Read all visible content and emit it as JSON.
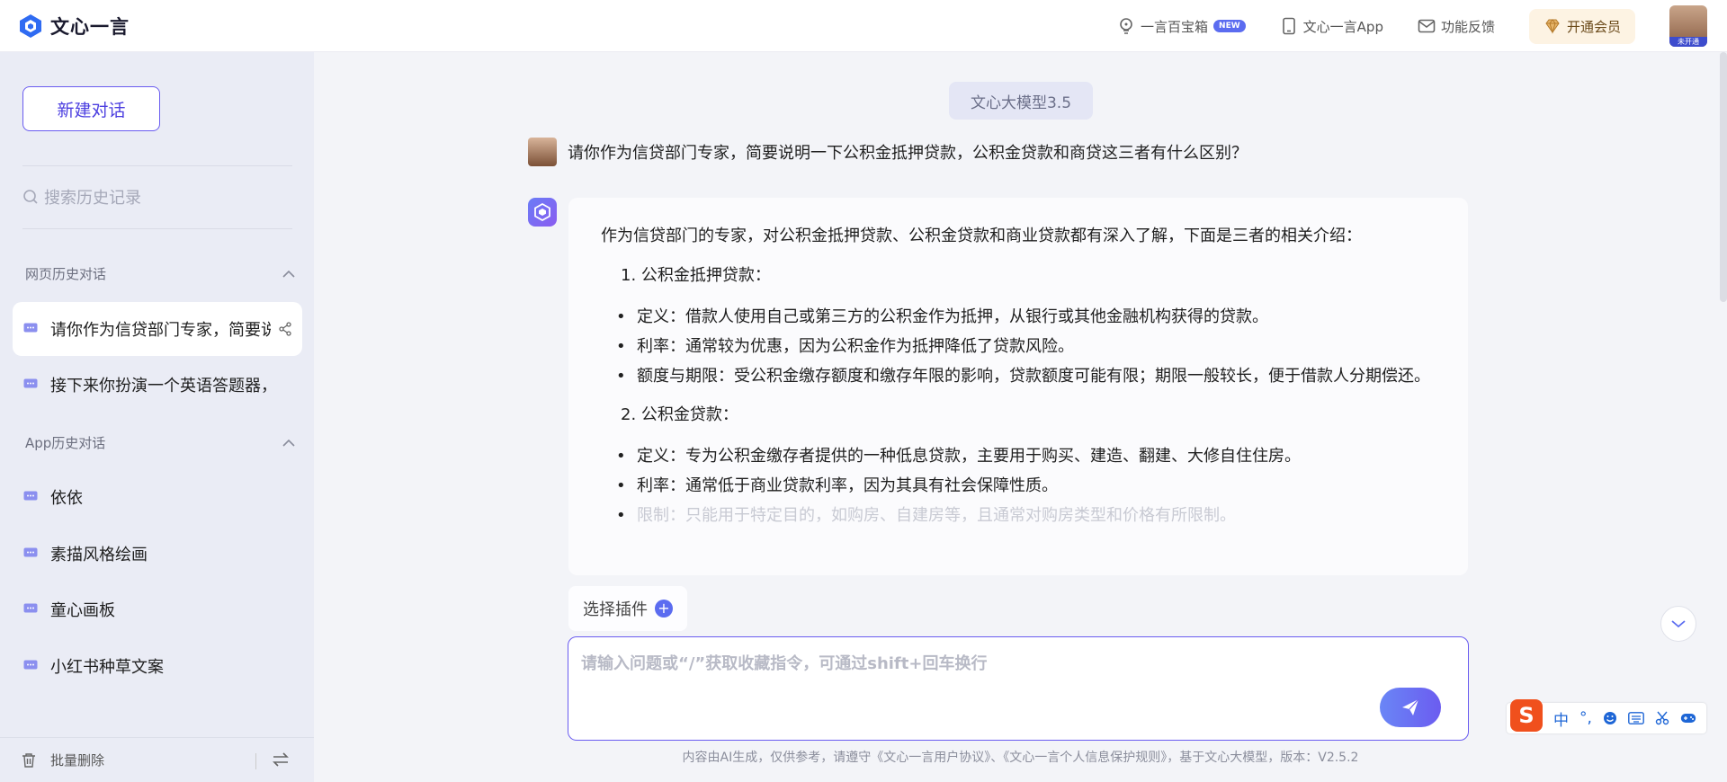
{
  "header": {
    "brand": "文心一言",
    "actions": [
      {
        "label": "一言百宝箱",
        "badge": "NEW",
        "icon": "bulb-icon"
      },
      {
        "label": "文心一言App",
        "icon": "phone-icon"
      },
      {
        "label": "功能反馈",
        "icon": "mail-icon"
      }
    ],
    "vip_label": "开通会员",
    "avatar_tag": "未开通"
  },
  "sidebar": {
    "new_chat": "新建对话",
    "search_placeholder": "搜索历史记录",
    "web_section": "网页历史对话",
    "web_items": [
      "请你作为信贷部门专家，简要说",
      "接下来你扮演一个英语答题器，我"
    ],
    "app_section": "App历史对话",
    "app_items": [
      "依依",
      "素描风格绘画",
      "童心画板",
      "小红书种草文案"
    ],
    "batch_delete": "批量删除"
  },
  "main": {
    "model": "文心大模型3.5",
    "question": "请你作为信贷部门专家，简要说明一下公积金抵押贷款，公积金贷款和商贷这三者有什么区别？",
    "answer": {
      "intro": "作为信贷部门的专家，对公积金抵押贷款、公积金贷款和商业贷款都有深入了解，下面是三者的相关介绍：",
      "sec1_title": "1. 公积金抵押贷款：",
      "sec1_b1": "定义：借款人使用自己或第三方的公积金作为抵押，从银行或其他金融机构获得的贷款。",
      "sec1_b2": "利率：通常较为优惠，因为公积金作为抵押降低了贷款风险。",
      "sec1_b3": "额度与期限：受公积金缴存额度和缴存年限的影响，贷款额度可能有限；期限一般较长，便于借款人分期偿还。",
      "sec2_title": "2. 公积金贷款：",
      "sec2_b1": "定义：专为公积金缴存者提供的一种低息贷款，主要用于购买、建造、翻建、大修自住住房。",
      "sec2_b2": "利率：通常低于商业贷款利率，因为其具有社会保障性质。",
      "sec2_b3": "限制：只能用于特定目的，如购房、自建房等，且通常对购房类型和价格有所限制。"
    },
    "plugin_label": "选择插件",
    "input_placeholder": "请输入问题或“/”获取收藏指令，可通过shift+回车换行",
    "footer": "内容由AI生成，仅供参考，请遵守《文心一言用户协议》、《文心一言个人信息保护规则》，基于文心大模型，版本：V2.5.2"
  },
  "ime": {
    "logo": "S",
    "mode": "中"
  },
  "colors": {
    "accent": "#6a5cf0",
    "sidebar_bg": "#eaecf5",
    "main_bg": "#f3f4f8"
  }
}
